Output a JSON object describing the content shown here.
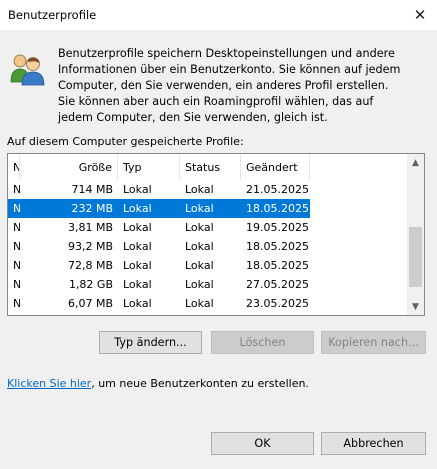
{
  "window": {
    "title": "Benutzerprofile"
  },
  "intro": {
    "icon": "users-icon",
    "text": "Benutzerprofile speichern Desktopeinstellungen und andere Informationen über ein Benutzerkonto. Sie können auf jedem Computer, den Sie verwenden, ein anderes Profil erstellen. Sie können aber auch ein Roamingprofil wählen, das auf jedem Computer, den Sie verwenden, gleich ist."
  },
  "profiles": {
    "label": "Auf diesem Computer gespeicherte Profile:",
    "columns": [
      "N",
      "Größe",
      "Typ",
      "Status",
      "Geändert"
    ],
    "rows": [
      {
        "name": "N",
        "size": "714 MB",
        "type": "Lokal",
        "status": "Lokal",
        "changed": "21.05.2025",
        "selected": false
      },
      {
        "name": "N",
        "size": "232 MB",
        "type": "Lokal",
        "status": "Lokal",
        "changed": "18.05.2025",
        "selected": true
      },
      {
        "name": "N",
        "size": "3,81 MB",
        "type": "Lokal",
        "status": "Lokal",
        "changed": "19.05.2025",
        "selected": false
      },
      {
        "name": "N",
        "size": "93,2 MB",
        "type": "Lokal",
        "status": "Lokal",
        "changed": "18.05.2025",
        "selected": false
      },
      {
        "name": "N",
        "size": "72,8 MB",
        "type": "Lokal",
        "status": "Lokal",
        "changed": "18.05.2025",
        "selected": false
      },
      {
        "name": "N",
        "size": "1,82 GB",
        "type": "Lokal",
        "status": "Lokal",
        "changed": "27.05.2025",
        "selected": false
      },
      {
        "name": "N",
        "size": "6,07 MB",
        "type": "Lokal",
        "status": "Lokal",
        "changed": "23.05.2025",
        "selected": false
      }
    ]
  },
  "buttons": {
    "change_type": "Typ ändern...",
    "delete": "Löschen",
    "copy": "Kopieren nach...",
    "ok": "OK",
    "cancel": "Abbrechen"
  },
  "footer": {
    "link": "Klicken Sie hier",
    "text": ", um neue Benutzerkonten zu erstellen."
  },
  "colors": {
    "selection": "#0078d7",
    "link": "#0066cc"
  }
}
